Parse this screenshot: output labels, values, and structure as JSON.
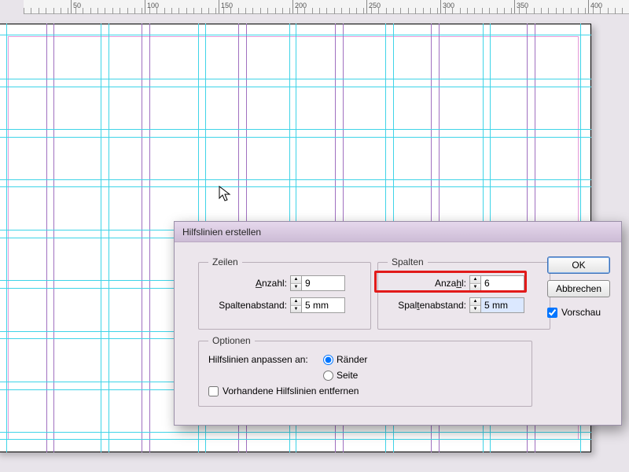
{
  "ruler": {
    "majors": [
      50,
      100,
      150,
      200,
      250,
      300,
      350,
      400
    ]
  },
  "dialog": {
    "title": "Hilfslinien erstellen",
    "rows": {
      "legend": "Zeilen",
      "count_label": "Anzahl:",
      "count_value": "9",
      "gutter_label": "Spaltenabstand:",
      "gutter_value": "5 mm"
    },
    "cols": {
      "legend": "Spalten",
      "count_label": "Anzahl:",
      "count_value": "6",
      "gutter_label": "Spaltenabstand:",
      "gutter_value": "5 mm"
    },
    "options": {
      "legend": "Optionen",
      "fit_label": "Hilfslinien anpassen an:",
      "radio_margins": "Ränder",
      "radio_page": "Seite",
      "remove_existing": "Vorhandene Hilfslinien entfernen"
    },
    "buttons": {
      "ok": "OK",
      "cancel": "Abbrechen"
    },
    "preview_label": "Vorschau",
    "preview_checked": true
  }
}
